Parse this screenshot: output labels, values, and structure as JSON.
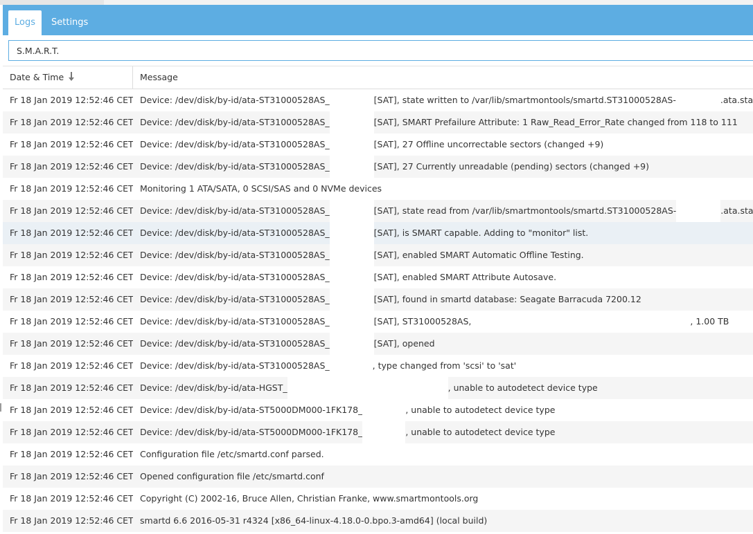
{
  "tabs": [
    {
      "label": "Logs",
      "active": true
    },
    {
      "label": "Settings",
      "active": false
    }
  ],
  "filter": {
    "value": "S.M.A.R.T."
  },
  "columns": {
    "date": "Date & Time",
    "message": "Message"
  },
  "colors": {
    "accent": "#5dade2",
    "row_alt": "#f5f5f5",
    "row_hover": "#eaf0f5"
  },
  "rows": [
    {
      "date": "Fr 18 Jan 2019 12:52:46 CET",
      "parts": [
        "Device: /dev/disk/by-id/ata-ST31000528AS_",
        "[SAT], state written to /var/lib/smartmontools/smartd.ST31000528AS-",
        ".ata.state"
      ]
    },
    {
      "date": "Fr 18 Jan 2019 12:52:46 CET",
      "parts": [
        "Device: /dev/disk/by-id/ata-ST31000528AS_",
        "[SAT], SMART Prefailure Attribute: 1 Raw_Read_Error_Rate changed from 118 to 111"
      ]
    },
    {
      "date": "Fr 18 Jan 2019 12:52:46 CET",
      "parts": [
        "Device: /dev/disk/by-id/ata-ST31000528AS_",
        "[SAT], 27 Offline uncorrectable sectors (changed +9)"
      ]
    },
    {
      "date": "Fr 18 Jan 2019 12:52:46 CET",
      "parts": [
        "Device: /dev/disk/by-id/ata-ST31000528AS_",
        "[SAT], 27 Currently unreadable (pending) sectors (changed +9)"
      ]
    },
    {
      "date": "Fr 18 Jan 2019 12:52:46 CET",
      "parts": [
        "Monitoring 1 ATA/SATA, 0 SCSI/SAS and 0 NVMe devices"
      ]
    },
    {
      "date": "Fr 18 Jan 2019 12:52:46 CET",
      "parts": [
        "Device: /dev/disk/by-id/ata-ST31000528AS_",
        "[SAT], state read from /var/lib/smartmontools/smartd.ST31000528AS-",
        ".ata.state"
      ]
    },
    {
      "date": "Fr 18 Jan 2019 12:52:46 CET",
      "parts": [
        "Device: /dev/disk/by-id/ata-ST31000528AS_",
        "[SAT], is SMART capable. Adding to \"monitor\" list."
      ]
    },
    {
      "date": "Fr 18 Jan 2019 12:52:46 CET",
      "parts": [
        "Device: /dev/disk/by-id/ata-ST31000528AS_",
        "[SAT], enabled SMART Automatic Offline Testing."
      ]
    },
    {
      "date": "Fr 18 Jan 2019 12:52:46 CET",
      "parts": [
        "Device: /dev/disk/by-id/ata-ST31000528AS_",
        "[SAT], enabled SMART Attribute Autosave."
      ]
    },
    {
      "date": "Fr 18 Jan 2019 12:52:46 CET",
      "parts": [
        "Device: /dev/disk/by-id/ata-ST31000528AS_",
        "[SAT], found in smartd database: Seagate Barracuda 7200.12"
      ]
    },
    {
      "date": "Fr 18 Jan 2019 12:52:46 CET",
      "parts": [
        "Device: /dev/disk/by-id/ata-ST31000528AS_",
        "[SAT], ST31000528AS,",
        ", 1.00 TB"
      ]
    },
    {
      "date": "Fr 18 Jan 2019 12:52:46 CET",
      "parts": [
        "Device: /dev/disk/by-id/ata-ST31000528AS_",
        "[SAT], opened"
      ]
    },
    {
      "date": "Fr 18 Jan 2019 12:52:46 CET",
      "parts": [
        "Device: /dev/disk/by-id/ata-ST31000528AS_",
        ", type changed from 'scsi' to 'sat'"
      ]
    },
    {
      "date": "Fr 18 Jan 2019 12:52:46 CET",
      "parts": [
        "Device: /dev/disk/by-id/ata-HGST_",
        ", unable to autodetect device type"
      ]
    },
    {
      "date": "Fr 18 Jan 2019 12:52:46 CET",
      "parts": [
        "Device: /dev/disk/by-id/ata-ST5000DM000-1FK178_",
        ", unable to autodetect device type"
      ]
    },
    {
      "date": "Fr 18 Jan 2019 12:52:46 CET",
      "parts": [
        "Device: /dev/disk/by-id/ata-ST5000DM000-1FK178_",
        ", unable to autodetect device type"
      ]
    },
    {
      "date": "Fr 18 Jan 2019 12:52:46 CET",
      "parts": [
        "Configuration file /etc/smartd.conf parsed."
      ]
    },
    {
      "date": "Fr 18 Jan 2019 12:52:46 CET",
      "parts": [
        "Opened configuration file /etc/smartd.conf"
      ]
    },
    {
      "date": "Fr 18 Jan 2019 12:52:46 CET",
      "parts": [
        "Copyright (C) 2002-16, Bruce Allen, Christian Franke, www.smartmontools.org"
      ]
    },
    {
      "date": "Fr 18 Jan 2019 12:52:46 CET",
      "parts": [
        "smartd 6.6 2016-05-31 r4324 [x86_64-linux-4.18.0-0.bpo.3-amd64] (local build)"
      ]
    }
  ]
}
